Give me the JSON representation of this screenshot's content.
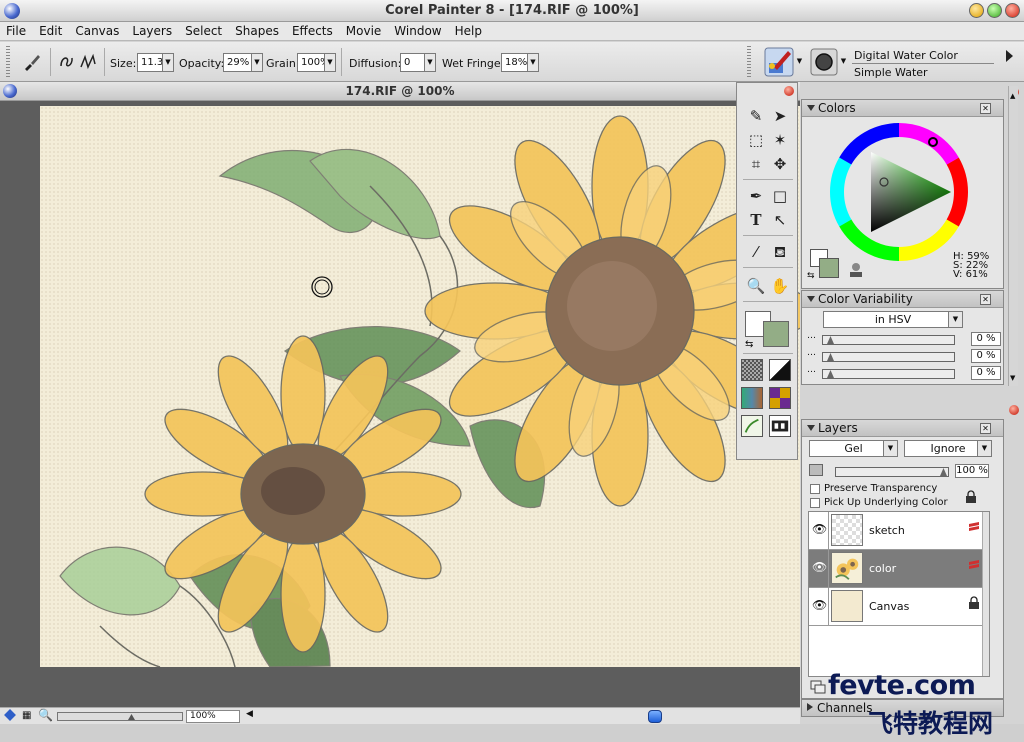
{
  "window": {
    "title": "Corel Painter 8 - [174.RIF @ 100%]"
  },
  "menu": [
    "File",
    "Edit",
    "Canvas",
    "Layers",
    "Select",
    "Shapes",
    "Effects",
    "Movie",
    "Window",
    "Help"
  ],
  "propbar": {
    "size_label": "Size:",
    "size_value": "11.3",
    "opacity_label": "Opacity:",
    "opacity_value": "29%",
    "grain_label": "Grain:",
    "grain_value": "100%",
    "diffusion_label": "Diffusion:",
    "diffusion_value": "0",
    "wetfringe_label": "Wet Fringe:",
    "wetfringe_value": "18%",
    "brush_category": "Digital Water Color",
    "brush_variant": "Simple Water"
  },
  "document": {
    "title": "174.RIF @ 100%",
    "zoom": "100%"
  },
  "colors_panel": {
    "title": "Colors",
    "h": "H: 59%",
    "s": "S: 22%",
    "v": "V: 61%",
    "primary_color": "#93ad86",
    "secondary_color": "#ffffff"
  },
  "variability_panel": {
    "title": "Color Variability",
    "mode": "in HSV",
    "values": [
      "0 %",
      "0 %",
      "0 %"
    ]
  },
  "layers_panel": {
    "title": "Layers",
    "composite_method": "Gel",
    "depth": "Ignore",
    "opacity": "100 %",
    "preserve_transparency": "Preserve Transparency",
    "pick_up_underlying": "Pick Up Underlying Color",
    "layers": [
      {
        "name": "sketch",
        "selected": false
      },
      {
        "name": "color",
        "selected": true
      },
      {
        "name": "Canvas",
        "selected": false
      }
    ]
  },
  "channels_panel": {
    "title": "Channels"
  },
  "watermark": {
    "line1": "fevte.com",
    "line2": "飞特教程网"
  }
}
